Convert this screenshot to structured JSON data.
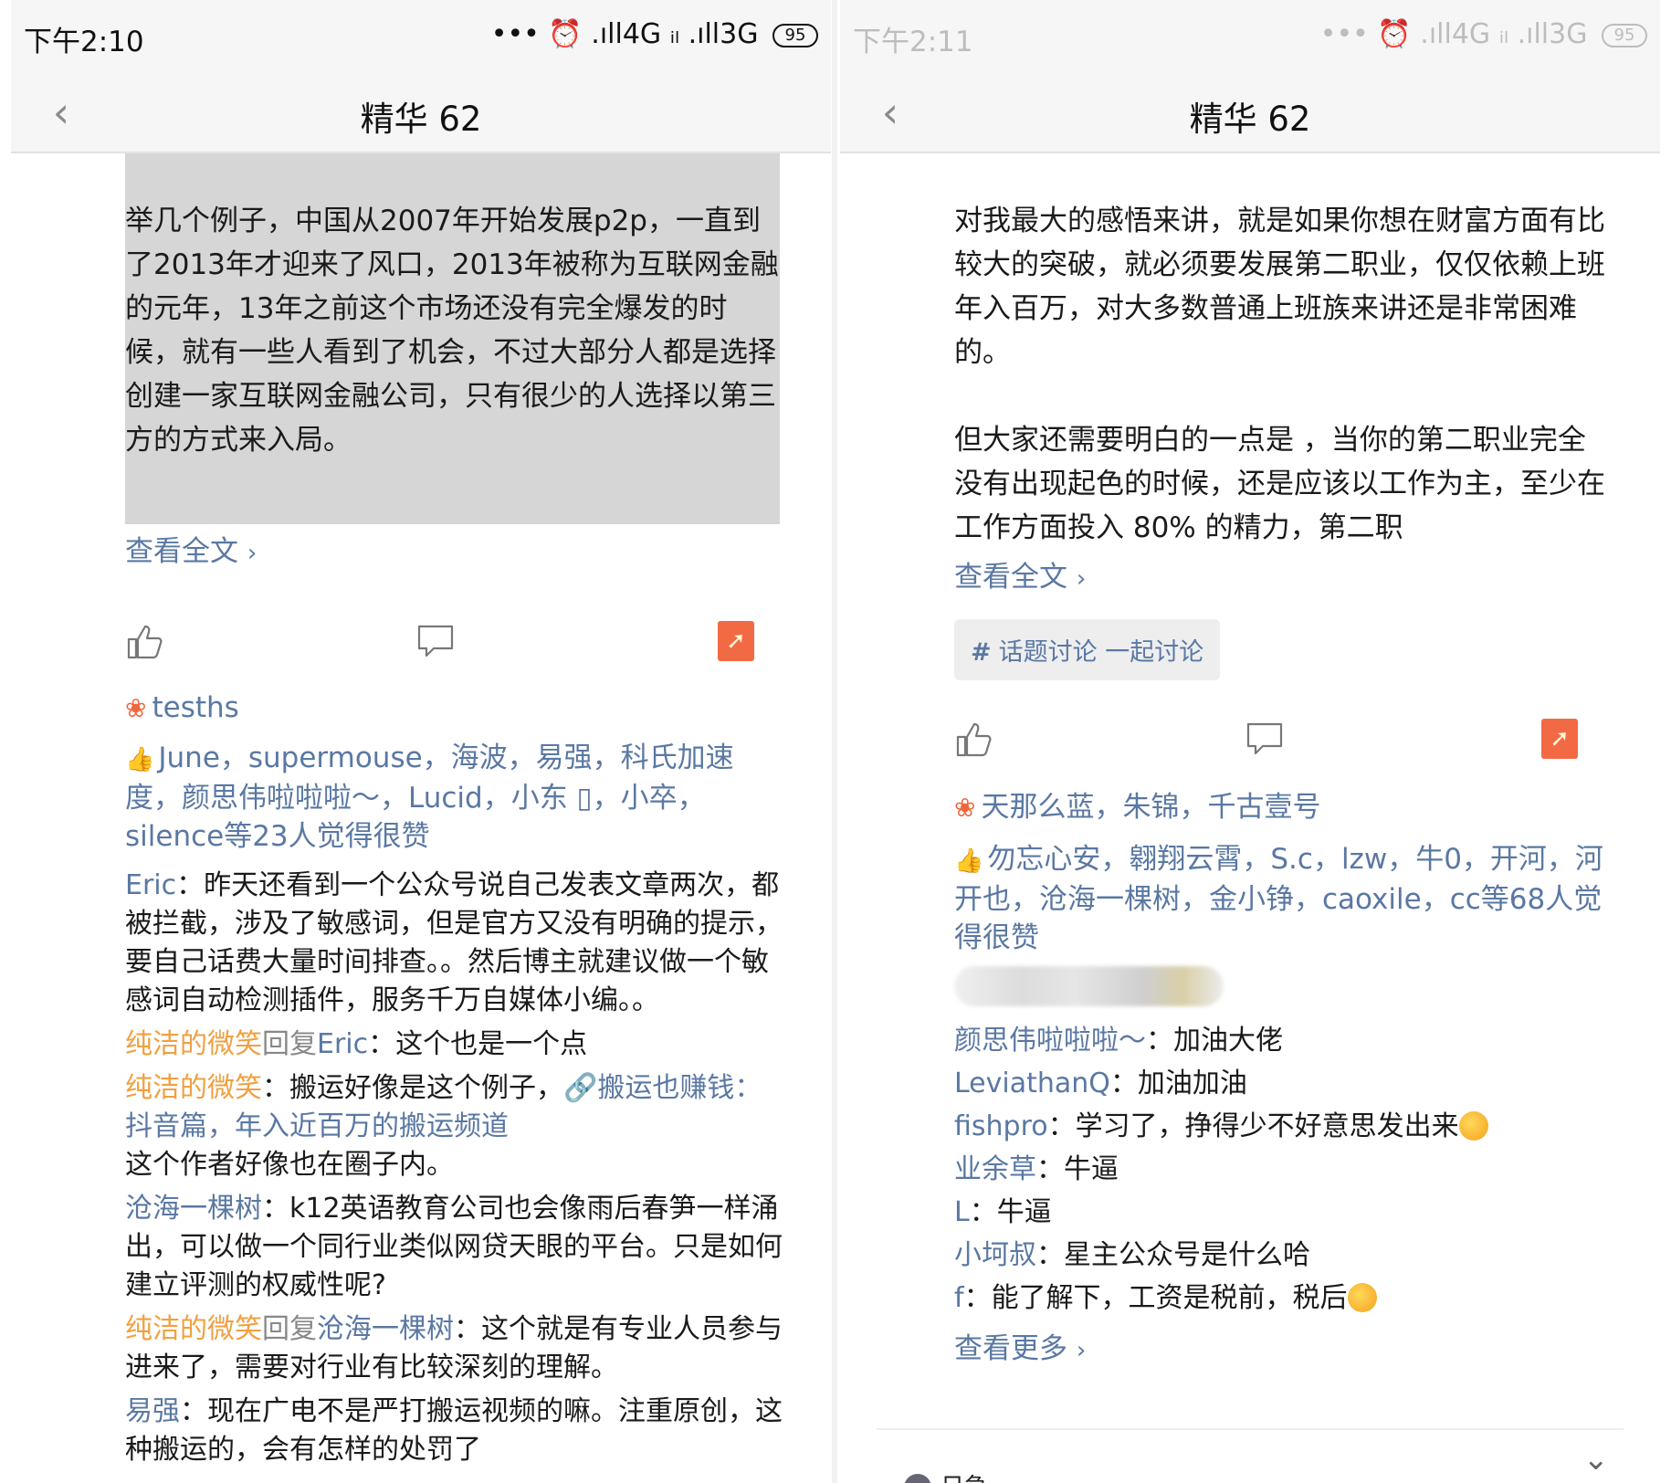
{
  "left": {
    "status": {
      "time": "下午2:10",
      "network": "••• ⏰ .ıll4G ᵢₗ .ıll3G",
      "battery": "95"
    },
    "nav": {
      "title": "精华 62",
      "back": "‹"
    },
    "post": {
      "text": "举几个例子，中国从2007年开始发展p2p，一直到了2013年才迎来了风口，2013年被称为互联网金融的元年，13年之前这个市场还没有完全爆发的时候，就有一些人看到了机会，不过大部分人都是选择创建一家互联网金融公司，只有很少的人选择以第三方的方式来入局。",
      "read_full": "查看全文",
      "chev": "›"
    },
    "reward_name": "tesths",
    "likes_text": "June，supermouse，海波，易强，科氏加速度，颜思伟啦啦啦～，Lucid，小东 ▯，小卒，silence等23人觉得很赞",
    "comments": [
      {
        "author": "Eric",
        "sep": "：",
        "text": "昨天还看到一个公众号说自己发表文章两次，都被拦截，涉及了敏感词，但是官方又没有明确的提示，要自己话费大量时间排查。。然后博主就建议做一个敏感词自动检测插件，服务千万自媒体小编。。"
      },
      {
        "author": "纯洁的微笑",
        "reply_word": "回复",
        "reply_to": "Eric",
        "sep": "：",
        "text": "这个也是一个点"
      },
      {
        "author": "纯洁的微笑",
        "sep": "：",
        "text": "搬运好像是这个例子，",
        "link_icon": "🔗",
        "link_text": "搬运也赚钱：抖音篇，年入近百万的搬运频道",
        "tail": "这个作者好像也在圈子内。"
      },
      {
        "author": "沧海一棵树",
        "sep": "：",
        "text": "k12英语教育公司也会像雨后春笋一样涌出，可以做一个同行业类似网贷天眼的平台。只是如何建立评测的权威性呢?"
      },
      {
        "author": "纯洁的微笑",
        "reply_word": "回复",
        "reply_to": "沧海一棵树",
        "sep": "：",
        "text": "这个就是有专业人员参与进来了，需要对行业有比较深刻的理解。"
      },
      {
        "author": "易强",
        "sep": "：",
        "text": "现在广电不是严打搬运视频的嘛。注重原创，这种搬运的，会有怎样的处罚了"
      }
    ]
  },
  "right": {
    "status": {
      "time": "下午2:11",
      "network": "••• ⏰ .ıll4G ᵢₗ .ıll3G",
      "battery": "95"
    },
    "nav": {
      "title": "精华 62",
      "back": "‹"
    },
    "post": {
      "para1": "对我最大的感悟来讲，就是如果你想在财富方面有比较大的突破，就必须要发展第二职业，仅仅依赖上班年入百万，对大多数普通上班族来讲还是非常困难的。",
      "para2": "但大家还需要明白的一点是 ，当你的第二职业完全没有出现起色的时候，还是应该以工作为主，至少在工作方面投入 80% 的精力，第二职",
      "read_full": "查看全文",
      "chev": "›"
    },
    "topic": {
      "hash": "#",
      "label": "话题讨论 一起讨论"
    },
    "reward_names": "天那么蓝，朱锦，千古壹号",
    "likes_text": "勿忘心安，翱翔云霄，S.c，lzw，牛0，开河，河开也，沧海一棵树，金小铮，caoxile，cc等68人觉得很赞",
    "comments": [
      {
        "author": "颜思伟啦啦啦～",
        "sep": "：",
        "text": "加油大佬"
      },
      {
        "author": "LeviathanQ",
        "sep": "：",
        "text": "加油加油"
      },
      {
        "author": "fishpro",
        "sep": "：",
        "text": "学习了，挣得少不好意思发出来",
        "emoji": true
      },
      {
        "author": "业余草",
        "sep": "：",
        "text": "牛逼"
      },
      {
        "author": "L",
        "sep": "：",
        "text": "牛逼"
      },
      {
        "author": "小坷叔",
        "sep": "：",
        "text": "星主公众号是什么哈"
      },
      {
        "author": "f",
        "sep": "：",
        "text": "能了解下，工资是税前，税后",
        "emoji": true
      }
    ],
    "see_more": "查看更多",
    "see_more_chev": "›",
    "bottom_chev": "⌄",
    "bottom_partial_text": "日急"
  },
  "colors": {
    "link_blue": "#5a78a3",
    "orange_name": "#f0a041",
    "share_orange": "#f26a43",
    "highlight_gray": "#d6d6d6"
  },
  "icons": {
    "like": "thumbs-up-icon",
    "comment": "comment-bubble-icon",
    "share": "share-arrow-icon",
    "reward": "flower-icon",
    "back": "back-chevron-icon"
  }
}
